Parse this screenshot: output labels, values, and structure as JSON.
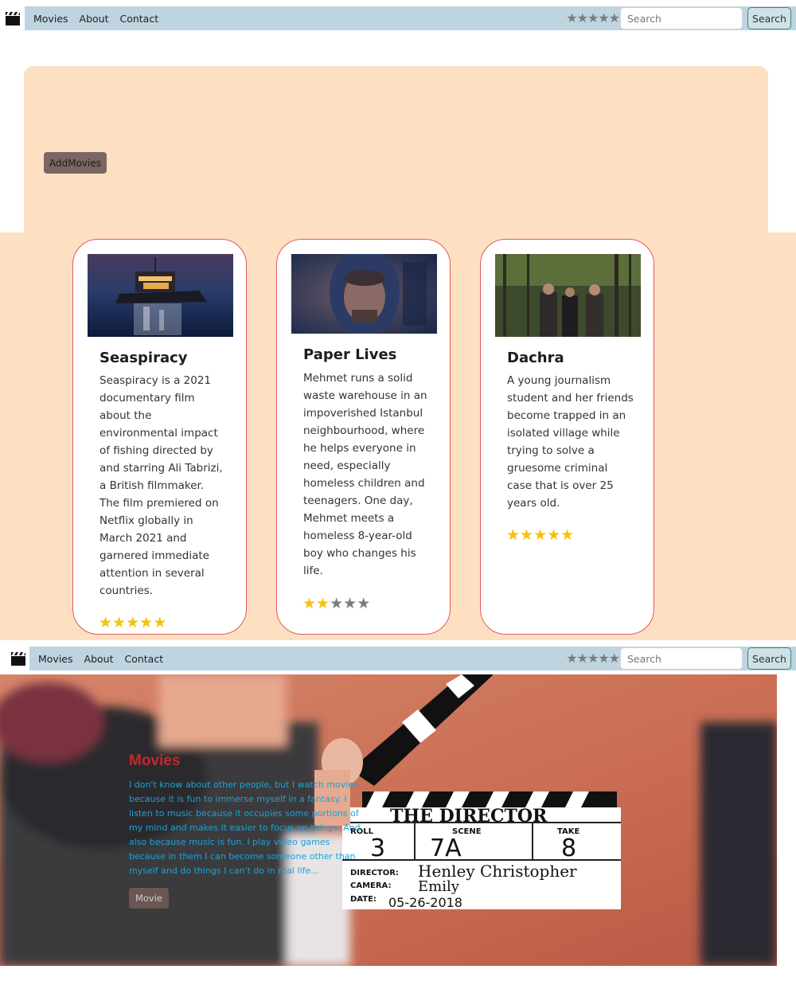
{
  "nav": {
    "links": [
      "Movies",
      "About",
      "Contact"
    ],
    "rating": 0,
    "search_placeholder": "Search",
    "search_button": "Search"
  },
  "hero": {
    "add_button": "AddMovies"
  },
  "movies": [
    {
      "title": "Seaspiracy",
      "description": "Seaspiracy is a 2021 documentary film about the environmental impact of fishing directed by and starring Ali Tabrizi, a British filmmaker. The film premiered on Netflix globally in March 2021 and garnered immediate attention in several countries.",
      "rating": 5
    },
    {
      "title": "Paper Lives",
      "description": "Mehmet runs a solid waste warehouse in an impoverished Istanbul neighbourhood, where he helps everyone in need, especially homeless children and teenagers. One day, Mehmet meets a homeless 8-year-old boy who changes his life.",
      "rating": 2
    },
    {
      "title": "Dachra",
      "description": "A young journalism student and her friends become trapped in an isolated village while trying to solve a gruesome criminal case that is over 25 years old.",
      "rating": 5
    }
  ],
  "banner": {
    "title": "Movies",
    "text": "I don't know about other people, but I watch movies because it is fun to immerse myself in a fantasy. I listen to music because it occupies some portions of my mind and makes it easier to focus on things. And also because music is fun. I play video games because in them I can become someone other than myself and do things I can't do in real life...",
    "button": "Movie"
  },
  "colors": {
    "nav_bar": "#bed4e1",
    "peach": "#fde0c2",
    "card_border": "#e25a5a",
    "star_filled": "#f4c20d",
    "star_empty": "#7b7b7b",
    "banner_title": "#c62828",
    "banner_text": "#1aa3d8"
  },
  "icons": {
    "logo": "clapperboard-icon"
  }
}
